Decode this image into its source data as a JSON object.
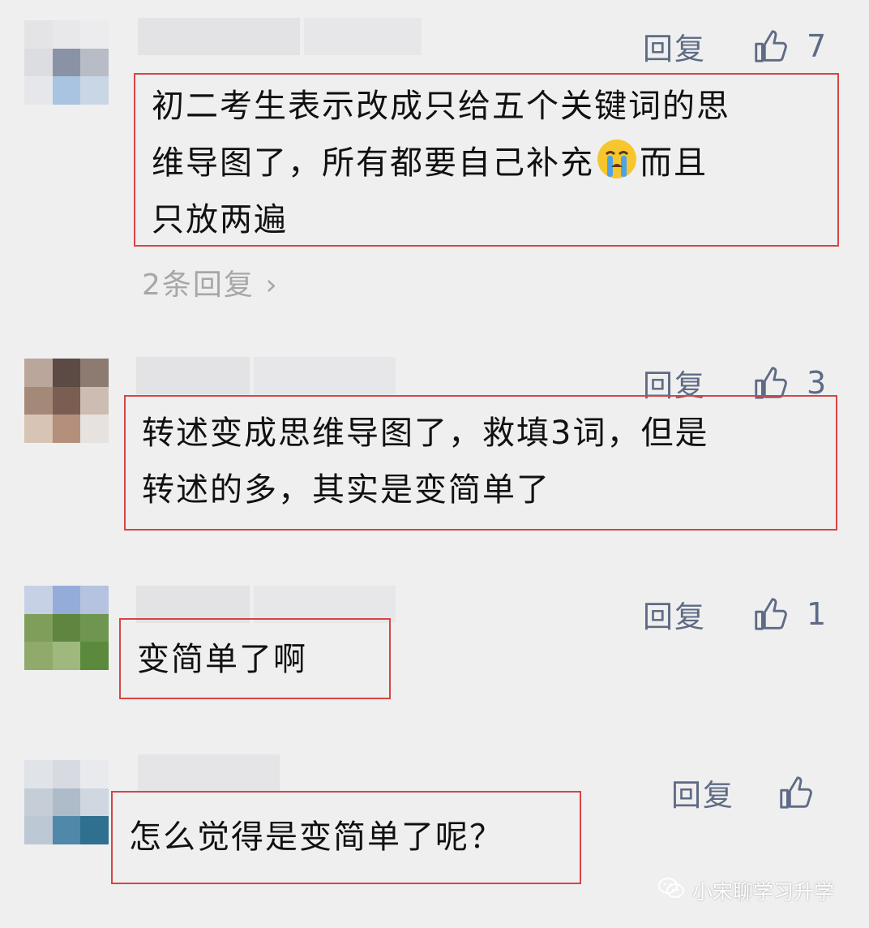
{
  "colors": {
    "background": "#efefef",
    "highlight_border": "#d64545",
    "action_text": "#5e6b85",
    "muted_text": "#a7a7a7"
  },
  "comments": [
    {
      "reply_label": "回复",
      "like_icon": "thumbs-up-icon",
      "like_count": "7",
      "text_lines": [
        "初二考生表示改成只给五个关键词的思",
        "维导图了，所有都要自己补充",
        "而且",
        "只放两遍"
      ],
      "emoji": "crying-face-emoji",
      "more_replies": "2条回复"
    },
    {
      "reply_label": "回复",
      "like_icon": "thumbs-up-icon",
      "like_count": "3",
      "text_lines": [
        "转述变成思维导图了，救填3词，但是",
        "转述的多，其实是变简单了"
      ]
    },
    {
      "reply_label": "回复",
      "like_icon": "thumbs-up-icon",
      "like_count": "1",
      "text_lines": [
        "变简单了啊"
      ]
    },
    {
      "reply_label": "回复",
      "like_icon": "thumbs-up-icon",
      "like_count": "",
      "text_lines": [
        "怎么觉得是变简单了呢？"
      ]
    }
  ],
  "watermark": {
    "icon": "wechat-icon",
    "text": "小宋聊学习升学"
  }
}
